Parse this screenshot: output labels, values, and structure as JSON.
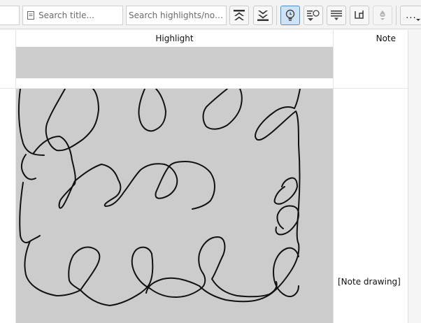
{
  "toolbar": {
    "title_search_placeholder": "Search title...",
    "notes_search_placeholder": "Search highlights/notes...",
    "more_label": "...",
    "buttons": [
      {
        "icon": "scroll-to-top-icon",
        "active": false
      },
      {
        "icon": "scroll-to-bottom-icon",
        "active": false
      },
      {
        "icon": "highlight-bulb-icon",
        "active": true
      },
      {
        "icon": "sort-by-bulb-icon",
        "active": false
      },
      {
        "icon": "list-filter-icon",
        "active": false
      },
      {
        "icon": "layout-icon",
        "active": false
      },
      {
        "icon": "marker-icon",
        "active": false
      }
    ],
    "active_color": "#cfe3f7"
  },
  "table": {
    "columns": [
      "Highlight",
      "Note"
    ],
    "rows": [
      {
        "highlight": "",
        "note": ""
      },
      {
        "highlight": "[drawing]",
        "note": "[Note drawing]"
      }
    ],
    "highlight_color": "#cccccc"
  }
}
